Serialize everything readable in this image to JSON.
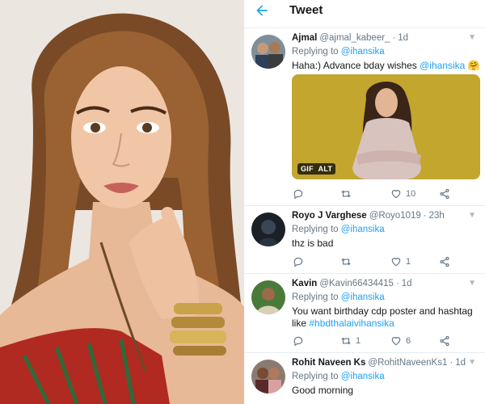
{
  "header": {
    "title": "Tweet",
    "back_icon": "arrow-left-icon"
  },
  "tweets": [
    {
      "name": "Ajmal",
      "handle": "@ajmal_kabeer_",
      "time": "1d",
      "replying_label": "Replying to",
      "replying_to": "@ihansika",
      "text": "Haha:) Advance bday wishes",
      "text_mention": "@ihansika",
      "emoji": "🤗",
      "media": {
        "type": "gif",
        "badge_gif": "GIF",
        "badge_alt": "ALT"
      },
      "replies": "",
      "retweets": "",
      "likes": "10"
    },
    {
      "name": "Royo J Varghese",
      "handle": "@Royo1019",
      "time": "23h",
      "replying_label": "Replying to",
      "replying_to": "@ihansika",
      "text": "thz is bad",
      "replies": "",
      "retweets": "",
      "likes": "1"
    },
    {
      "name": "Kavin",
      "handle": "@Kavin66434415",
      "time": "1d",
      "replying_label": "Replying to",
      "replying_to": "@ihansika",
      "text": "You want birthday cdp poster and hashtag like",
      "hashtag": "#hbdthalaivihansika",
      "replies": "",
      "retweets": "1",
      "likes": "6"
    },
    {
      "name": "Rohit Naveen Ks",
      "handle": "@RohitNaveenKs1",
      "time": "1d",
      "replying_label": "Replying to",
      "replying_to": "@ihansika",
      "text": "Good morning"
    }
  ],
  "colors": {
    "accent": "#1da1f2",
    "muted": "#657786",
    "text": "#14171a",
    "gif_bg": "#c2a62e"
  }
}
